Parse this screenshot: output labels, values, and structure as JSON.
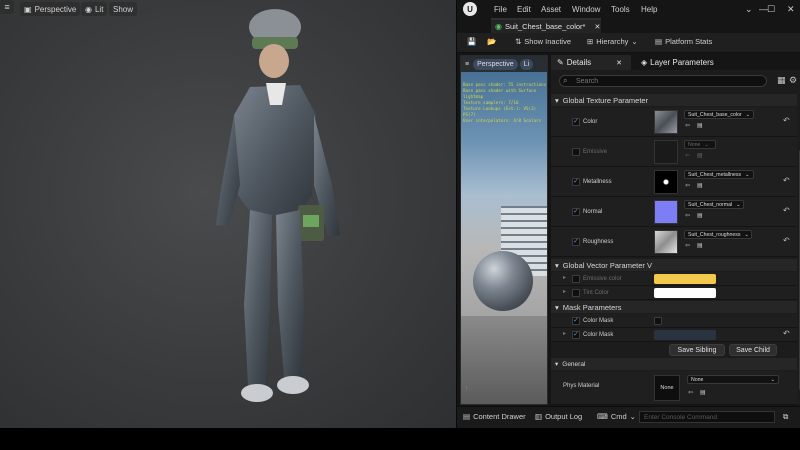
{
  "viewport": {
    "perspective_label": "Perspective",
    "lit_label": "Lit",
    "show_label": "Show"
  },
  "editor": {
    "menus": [
      "File",
      "Edit",
      "Asset",
      "Window",
      "Tools",
      "Help"
    ],
    "tab_title": "Suit_Chest_base_color*",
    "toolbar": {
      "show_inactive": "Show Inactive",
      "hierarchy": "Hierarchy",
      "platform_stats": "Platform Stats"
    },
    "preview": {
      "perspective_label": "Perspective",
      "lit_label": "Li",
      "stats_lines": [
        "Base pass shader: 55 instructions",
        "Base pass shader with Surface lightmap",
        "Texture samplers: 7/16",
        "Texture Lookups (Est.): VS(3) PS(7)",
        "User interpolators: 4/8 Scalars"
      ]
    },
    "details": {
      "tab_details": "Details",
      "tab_layer_params": "Layer Parameters",
      "search_placeholder": "Search",
      "groups": {
        "global_texture": "Global Texture Parameter",
        "global_vector": "Global Vector Parameter V",
        "mask": "Mask Parameters",
        "general": "General"
      },
      "texture_params": [
        {
          "label": "Color",
          "value": "Suit_Chest_base_color",
          "checked": true
        },
        {
          "label": "Emissive",
          "value": "None",
          "checked": false
        },
        {
          "label": "Metallness",
          "value": "Suit_Chest_metallness",
          "checked": true
        },
        {
          "label": "Normal",
          "value": "Suit_Chest_normal",
          "checked": true
        },
        {
          "label": "Roughness",
          "value": "Suit_Chest_roughness",
          "checked": true
        }
      ],
      "vector_params": [
        {
          "label": "Emissive color",
          "color": "#f2c94c"
        },
        {
          "label": "Tint Color",
          "color": "#ffffff"
        }
      ],
      "mask_params": [
        {
          "label": "Color Mask"
        },
        {
          "label": "Color Mask",
          "color": "#2a3441"
        }
      ],
      "buttons": {
        "save_sibling": "Save Sibling",
        "save_child": "Save Child"
      },
      "general": {
        "phys_material_label": "Phys Material",
        "thumb_text": "None",
        "dropdown_value": "None"
      }
    },
    "bottom": {
      "content_drawer": "Content Drawer",
      "output_log": "Output Log",
      "cmd": "Cmd",
      "console_placeholder": "Enter Console Command"
    }
  }
}
